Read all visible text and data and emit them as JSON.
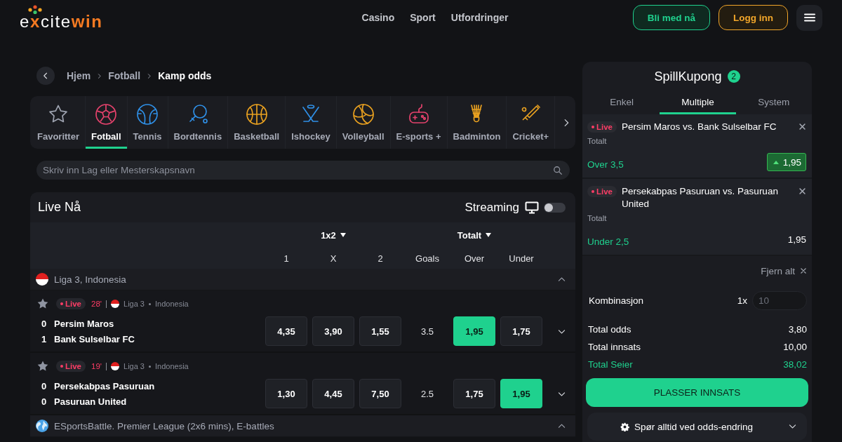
{
  "header": {
    "logo": {
      "segments": [
        {
          "text": "e",
          "kind": "plain"
        },
        {
          "text": "x",
          "kind": "accent"
        },
        {
          "text": "cite",
          "kind": "plain"
        },
        {
          "text": "win",
          "kind": "accent"
        }
      ]
    },
    "nav": [
      "Casino",
      "Sport",
      "Utfordringer"
    ],
    "join_button": "Bli med nå",
    "login_button": "Logg inn"
  },
  "breadcrumb": [
    "Hjem",
    "Fotball",
    "Kamp odds"
  ],
  "sports": [
    {
      "label": "Favoritter",
      "selected": false
    },
    {
      "label": "Fotball",
      "selected": true
    },
    {
      "label": "Tennis",
      "selected": false
    },
    {
      "label": "Bordtennis",
      "selected": false
    },
    {
      "label": "Basketball",
      "selected": false
    },
    {
      "label": "Ishockey",
      "selected": false
    },
    {
      "label": "Volleyball",
      "selected": false
    },
    {
      "label": "E-sports +",
      "selected": false
    },
    {
      "label": "Badminton",
      "selected": false
    },
    {
      "label": "Cricket+",
      "selected": false
    }
  ],
  "search": {
    "placeholder": "Skriv inn Lag eller Mesterskapsnavn"
  },
  "live": {
    "title": "Live Nå",
    "streaming": {
      "label": "Streaming",
      "on": false
    },
    "market_groups": [
      "1x2",
      "Totalt"
    ],
    "columns": [
      "1",
      "X",
      "2",
      "Goals",
      "Over",
      "Under"
    ],
    "leagues": [
      {
        "name": "Liga 3, Indonesia",
        "kind": "country",
        "expanded": true,
        "matches": [
          {
            "favorite": false,
            "status": "Live",
            "minute": "28'",
            "league": "Liga 3",
            "country": "Indonesia",
            "teams": [
              {
                "score": "0",
                "name": "Persim Maros"
              },
              {
                "score": "1",
                "name": "Bank Sulselbar FC"
              }
            ],
            "odds_1x2": [
              {
                "value": "4,35",
                "selected": false
              },
              {
                "value": "3,90",
                "selected": false
              },
              {
                "value": "1,55",
                "selected": false
              }
            ],
            "goal_line": "3.5",
            "odds_total": [
              {
                "value": "1,95",
                "selected": true
              },
              {
                "value": "1,75",
                "selected": false
              }
            ],
            "expanded": false
          },
          {
            "favorite": false,
            "status": "Live",
            "minute": "19'",
            "league": "Liga 3",
            "country": "Indonesia",
            "teams": [
              {
                "score": "0",
                "name": "Persekabpas Pasuruan"
              },
              {
                "score": "0",
                "name": "Pasuruan United"
              }
            ],
            "odds_1x2": [
              {
                "value": "1,30",
                "selected": false
              },
              {
                "value": "4,45",
                "selected": false
              },
              {
                "value": "7,50",
                "selected": false
              }
            ],
            "goal_line": "2.5",
            "odds_total": [
              {
                "value": "1,75",
                "selected": false
              },
              {
                "value": "1,95",
                "selected": true
              }
            ],
            "expanded": false
          }
        ]
      },
      {
        "name": "ESportsBattle. Premier League (2x6 mins), E-battles",
        "kind": "international",
        "expanded": true
      }
    ]
  },
  "betslip": {
    "title": "SpillKupong",
    "count": "2",
    "tabs": [
      {
        "label": "Enkel",
        "selected": false
      },
      {
        "label": "Multiple",
        "selected": true
      },
      {
        "label": "System",
        "selected": false
      }
    ],
    "bets": [
      {
        "status": "Live",
        "event": "Persim Maros vs. Bank Sulselbar FC",
        "market": "Totalt",
        "selection": "Over 3,5",
        "odds": "1,95",
        "odds_up": true
      },
      {
        "status": "Live",
        "event": "Persekabpas Pasuruan vs. Pasuruan United",
        "market": "Totalt",
        "selection": "Under 2,5",
        "odds": "1,95",
        "odds_up": false
      }
    ],
    "clear_all": "Fjern alt",
    "combination": {
      "label": "Kombinasjon",
      "multiplier": "1x",
      "stake": {
        "placeholder": "10"
      }
    },
    "summary": [
      {
        "label": "Total odds",
        "value": "3,80",
        "highlight": false
      },
      {
        "label": "Total innsats",
        "value": "10,00",
        "highlight": false
      },
      {
        "label": "Total Seier",
        "value": "38,02",
        "highlight": true
      }
    ],
    "place_button": "PLASSER INNSATS",
    "odds_change_setting": {
      "label": "Spør alltid ved odds-endring",
      "expanded": false
    }
  }
}
